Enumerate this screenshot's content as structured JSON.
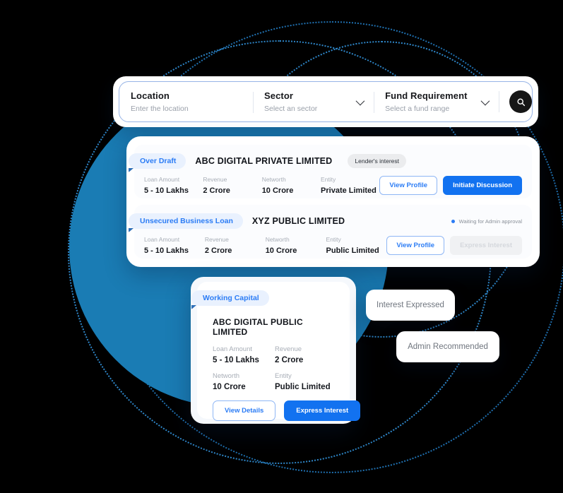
{
  "search": {
    "fields": [
      {
        "label": "Location",
        "placeholder": "Enter the location",
        "has_chevron": false,
        "icon": ""
      },
      {
        "label": "Sector",
        "placeholder": "Select an sector",
        "has_chevron": true,
        "icon": "chevron-down-icon"
      },
      {
        "label": "Fund Requirement",
        "placeholder": "Select a fund range",
        "has_chevron": true,
        "icon": "chevron-down-icon"
      }
    ],
    "search_button_icon": "search-icon"
  },
  "results": {
    "rows": [
      {
        "tag": "Over Draft",
        "company": "ABC DIGITAL PRIVATE LIMITED",
        "pill": "Lender's interest",
        "status": "",
        "fields": [
          {
            "label": "Loan Amount",
            "value": "5 - 10 Lakhs"
          },
          {
            "label": "Revenue",
            "value": "2 Crore"
          },
          {
            "label": "Networth",
            "value": "10 Crore"
          },
          {
            "label": "Entity",
            "value": "Private Limited"
          }
        ],
        "secondary_action": "View Profile",
        "primary_action": "Initiate Discussion"
      },
      {
        "tag": "Unsecured  Business Loan",
        "company": "XYZ PUBLIC LIMITED",
        "pill": "",
        "status": "Waiting for Admin approval",
        "fields": [
          {
            "label": "Loan Amount",
            "value": "5 - 10 Lakhs"
          },
          {
            "label": "Revenue",
            "value": "2 Crore"
          },
          {
            "label": "Networth",
            "value": "10 Crore"
          },
          {
            "label": "Entity",
            "value": "Public Limited"
          }
        ],
        "secondary_action": "View Profile",
        "primary_action": "Express Interest"
      }
    ]
  },
  "detail_card": {
    "tag": "Working Capital",
    "title": "ABC DIGITAL PUBLIC LIMITED",
    "fields": [
      {
        "label": "Loan Amount",
        "value": "5 - 10 Lakhs"
      },
      {
        "label": "Revenue",
        "value": "2 Crore"
      },
      {
        "label": "Networth",
        "value": "10 Crore"
      },
      {
        "label": "Entity",
        "value": "Public Limited"
      }
    ],
    "secondary_action": "View Details",
    "primary_action": "Express Interest"
  },
  "floating_pills": [
    {
      "label": "Interest Expressed"
    },
    {
      "label": "Admin Recommended"
    }
  ],
  "colors": {
    "brand_blue": "#1272F0",
    "circle_blue": "#1A7CB4",
    "arc_blue": "#2E86C8",
    "tag_bg": "#E9F1FE",
    "tag_text": "#2B7CF5",
    "status_dot": "#2B7CF5"
  }
}
